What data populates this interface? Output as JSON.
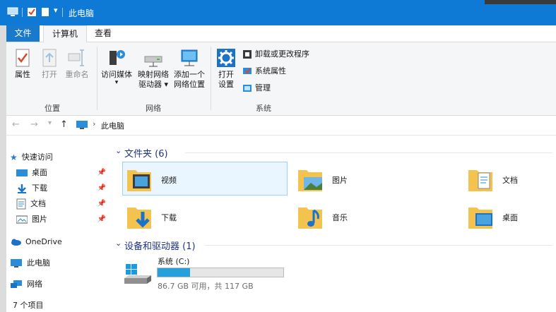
{
  "window": {
    "title": "此电脑",
    "colors": {
      "titlebar": "#0e7ad6",
      "file_tab": "#1979ca",
      "accent": "#26a0da",
      "section_header": "#1e3287",
      "selection": "#cce8ff"
    }
  },
  "tabs": {
    "file": "文件",
    "computer": "计算机",
    "view": "查看"
  },
  "ribbon": {
    "location": {
      "properties": "属性",
      "open": "打开",
      "rename": "重命名",
      "group_label": "位置"
    },
    "network": {
      "access_media": "访问媒体",
      "map_drive_line1": "映射网络",
      "map_drive_line2": "驱动器 ▾",
      "add_location_line1": "添加一个",
      "add_location_line2": "网络位置",
      "group_label": "网络"
    },
    "system": {
      "open_settings_line1": "打开",
      "open_settings_line2": "设置",
      "uninstall": "卸载或更改程序",
      "system_properties": "系统属性",
      "manage": "管理",
      "group_label": "系统"
    }
  },
  "address": {
    "path": "此电脑",
    "separator": "›"
  },
  "nav_pane": {
    "quick_access": "快速访问",
    "items": [
      {
        "label": "桌面",
        "icon": "desktop-icon"
      },
      {
        "label": "下载",
        "icon": "download-icon"
      },
      {
        "label": "文档",
        "icon": "document-icon"
      },
      {
        "label": "图片",
        "icon": "picture-icon"
      }
    ],
    "onedrive": "OneDrive",
    "this_pc": "此电脑",
    "network": "网络"
  },
  "content": {
    "folders_header": "文件夹 (6)",
    "folders": [
      {
        "label": "视频",
        "icon": "video-folder-icon"
      },
      {
        "label": "图片",
        "icon": "pictures-folder-icon"
      },
      {
        "label": "文档",
        "icon": "documents-folder-icon"
      },
      {
        "label": "下载",
        "icon": "downloads-folder-icon"
      },
      {
        "label": "音乐",
        "icon": "music-folder-icon"
      },
      {
        "label": "桌面",
        "icon": "desktop-folder-icon"
      }
    ],
    "devices_header": "设备和驱动器 (1)",
    "drive": {
      "name": "系统 (C:)",
      "free_text": "86.7 GB 可用，共 117 GB",
      "used_fraction": 0.26
    }
  },
  "status": {
    "count": "7 个项目"
  }
}
